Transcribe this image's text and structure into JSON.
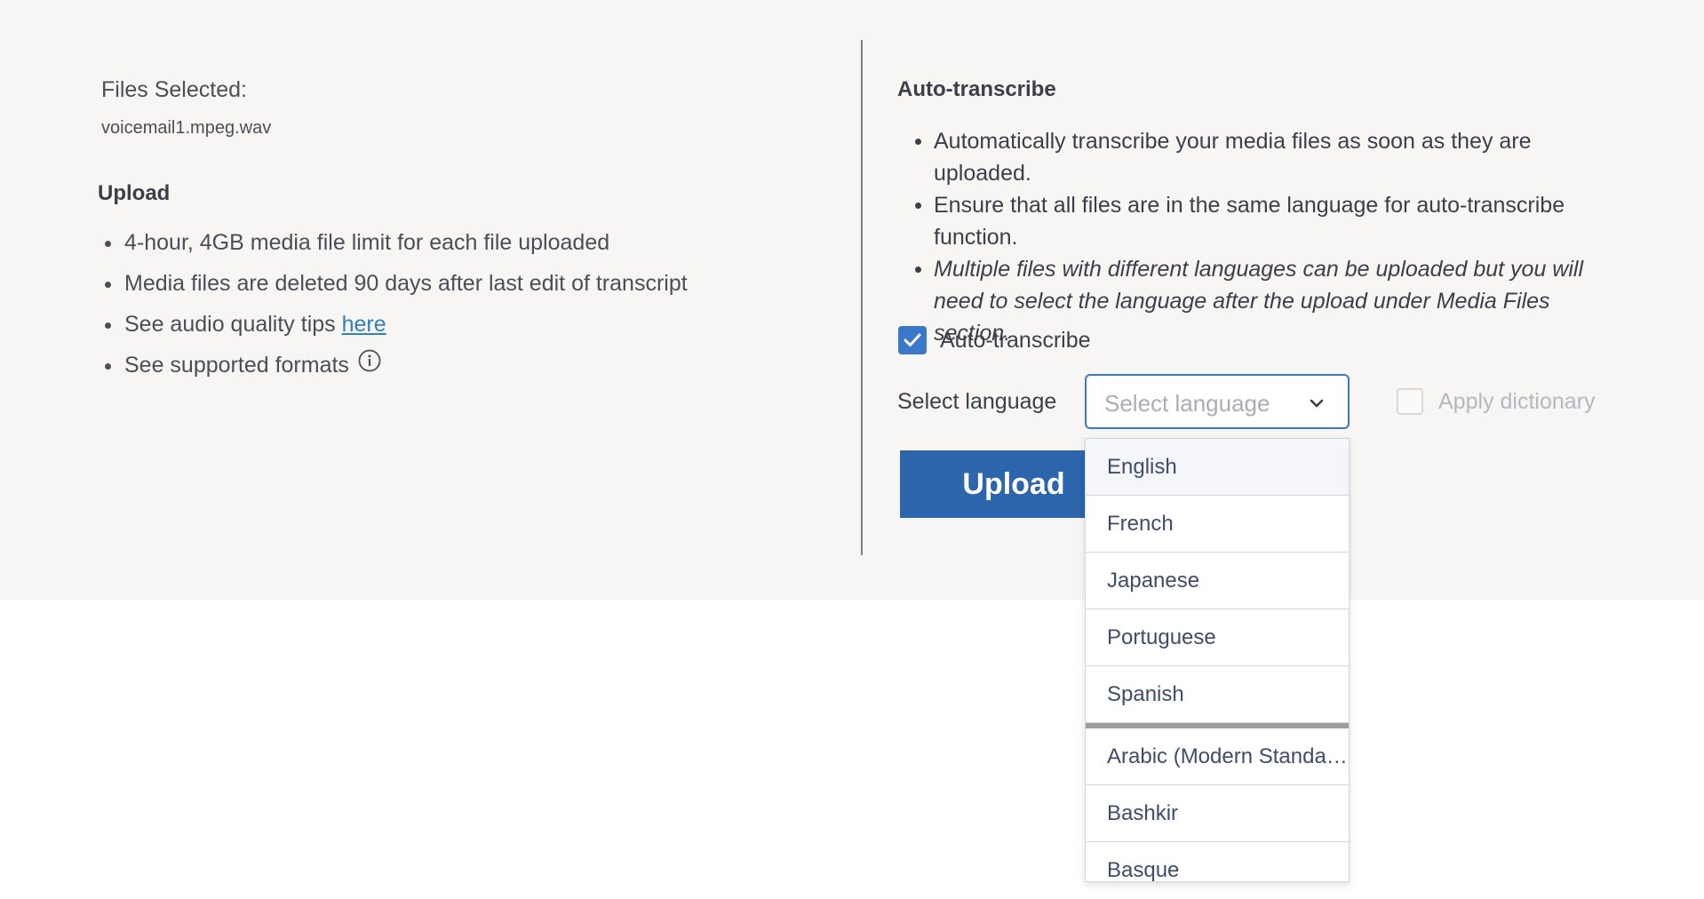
{
  "left": {
    "files_title": "Files Selected:",
    "file_name": "voicemail1.mpeg.wav",
    "upload_title": "Upload",
    "bullets": [
      "4-hour, 4GB media file limit for each file uploaded",
      "Media files are deleted 90 days after last edit of transcript"
    ],
    "tips_text": "See audio quality tips ",
    "tips_link": "here",
    "formats_text": "See supported formats"
  },
  "right": {
    "title": "Auto-transcribe",
    "bullets": [
      "Automatically transcribe your media files as soon as they are uploaded.",
      "Ensure that all files are in the same language for auto-transcribe function.",
      "Multiple files with different languages can be uploaded but you will need to select the language after the upload under Media Files section."
    ],
    "checkbox_label": "Auto-transcribe",
    "checkbox_checked": true,
    "select_label": "Select language",
    "select_placeholder": "Select language",
    "dictionary_label": "Apply dictionary",
    "upload_button": "Upload"
  },
  "dropdown": {
    "primary": [
      "English",
      "French",
      "Japanese",
      "Portuguese",
      "Spanish"
    ],
    "secondary": [
      "Arabic (Modern Standard)",
      "Bashkir",
      "Basque"
    ]
  },
  "colors": {
    "accent": "#3a78c9",
    "button": "#2c65ac",
    "link": "#2f7fc1",
    "panel_bg": "#f8f5f5"
  }
}
